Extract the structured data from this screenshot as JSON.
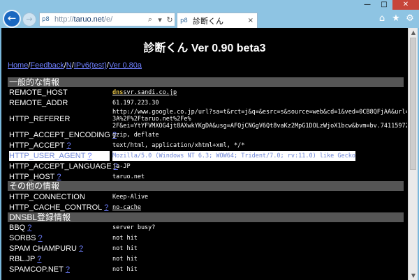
{
  "browser": {
    "address": {
      "url_prefix": "http://",
      "host": "taruo.net",
      "path": "/e/",
      "favicon": "p8",
      "search_icon": "⌕",
      "dropdown_icon": "▾",
      "refresh_icon": "↻"
    },
    "tab": {
      "favicon": "p8",
      "label": "診断くん",
      "close": "×"
    },
    "window_buttons": {
      "minimize": "—",
      "maximize": "□",
      "close": "✕"
    },
    "tool_icons": {
      "home": "⌂",
      "favorites": "★",
      "settings": "⚙"
    },
    "nav": {
      "back": "←",
      "forward": "→"
    }
  },
  "page": {
    "title": "診断くん Ver 0.90 beta3",
    "links": [
      {
        "label": "Home"
      },
      {
        "label": "Feedback"
      },
      {
        "label": "N"
      },
      {
        "label": "IPv6(test)"
      },
      {
        "label": "Ver 0.80a"
      }
    ],
    "separator": "/",
    "sections": {
      "general": "一般的な情報",
      "other": "その他の情報",
      "dnsbl": "DNSBL登録情報"
    },
    "general_rows": [
      {
        "key": "REMOTE_HOST",
        "val_hl": "dns",
        "val": "svr.sandi.co.jp"
      },
      {
        "key": "REMOTE_ADDR",
        "val": "61.197.223.30"
      },
      {
        "key": "HTTP_REFERER",
        "val_lines": [
          "http://www.google.co.jp/url?sa=t&rct=j&q=&esrc=s&source=web&cd=1&ved=0CB8QFjAA&url=http%",
          "3A%2F%2Ftaruo.net%2Fe%",
          "2F&ei=YtYFVMXOG4jt8AXwkYKgDA&usg=AFQjCNGgV6Qt8vaKz2MpG1DOLzWjoX1bcw&bvm=bv.74115972,d.dGc"
        ]
      },
      {
        "key": "HTTP_ACCEPT_ENCODING",
        "q": "?",
        "val": "gzip, deflate"
      },
      {
        "key": "HTTP_ACCEPT",
        "q": "?",
        "val": "text/html, application/xhtml+xml, */*"
      },
      {
        "key": "HTTP_USER_AGENT",
        "q": "?",
        "val": "Mozilla/5.0 (Windows NT 6.3; WOW64; Trident/7.0; rv:11.0) like Gecko"
      },
      {
        "key": "HTTP_ACCEPT_LANGUAGE",
        "q": "?",
        "val": "ja-JP"
      },
      {
        "key": "HTTP_HOST",
        "q": "?",
        "val": "taruo.net"
      }
    ],
    "other_rows": [
      {
        "key": "HTTP_CONNECTION",
        "val": "Keep-Alive"
      },
      {
        "key": "HTTP_CACHE_CONTROL",
        "q": "?",
        "val": "no-cache"
      }
    ],
    "dnsbl_rows": [
      {
        "key": "BBQ",
        "q": "?",
        "val": "server busy?"
      },
      {
        "key": "SORBS",
        "q": "?",
        "val": "not hit"
      },
      {
        "key": "SPAM CHAMPURU",
        "q": "?",
        "val": "not hit"
      },
      {
        "key": "RBL.JP",
        "q": "?",
        "val": "not hit"
      },
      {
        "key": "SPAMCOP.NET",
        "q": "?",
        "val": "not hit"
      }
    ]
  }
}
